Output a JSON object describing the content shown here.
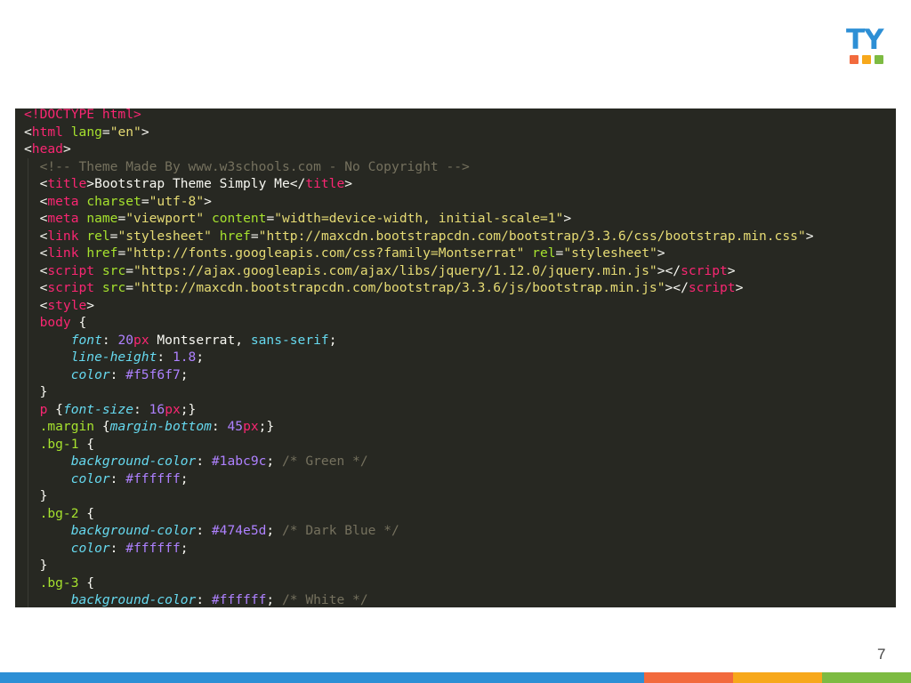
{
  "logo": {
    "text": "TY",
    "icon": "logo-mark",
    "bar_colors": [
      "#f26a3d",
      "#f7a81b",
      "#7dbb42"
    ],
    "text_color": "#2d8fd5"
  },
  "code": {
    "lines": [
      [
        [
          "t",
          "<!DOCTYPE html>"
        ]
      ],
      [
        [
          "pl",
          "<"
        ],
        [
          "t",
          "html"
        ],
        [
          "pl",
          " "
        ],
        [
          "a",
          "lang"
        ],
        [
          "pl",
          "="
        ],
        [
          "s",
          "\"en\""
        ],
        [
          "pl",
          ">"
        ]
      ],
      [
        [
          "pl",
          "<"
        ],
        [
          "t",
          "head"
        ],
        [
          "pl",
          ">"
        ]
      ],
      [
        [
          "pl",
          "  "
        ],
        [
          "c",
          "<!-- Theme Made By www.w3schools.com - No Copyright -->"
        ]
      ],
      [
        [
          "pl",
          "  <"
        ],
        [
          "t",
          "title"
        ],
        [
          "pl",
          ">Bootstrap Theme Simply Me</"
        ],
        [
          "t",
          "title"
        ],
        [
          "pl",
          ">"
        ]
      ],
      [
        [
          "pl",
          "  <"
        ],
        [
          "t",
          "meta"
        ],
        [
          "pl",
          " "
        ],
        [
          "a",
          "charset"
        ],
        [
          "pl",
          "="
        ],
        [
          "s",
          "\"utf-8\""
        ],
        [
          "pl",
          ">"
        ]
      ],
      [
        [
          "pl",
          "  <"
        ],
        [
          "t",
          "meta"
        ],
        [
          "pl",
          " "
        ],
        [
          "a",
          "name"
        ],
        [
          "pl",
          "="
        ],
        [
          "s",
          "\"viewport\""
        ],
        [
          "pl",
          " "
        ],
        [
          "a",
          "content"
        ],
        [
          "pl",
          "="
        ],
        [
          "s",
          "\"width=device-width, initial-scale=1\""
        ],
        [
          "pl",
          ">"
        ]
      ],
      [
        [
          "pl",
          "  <"
        ],
        [
          "t",
          "link"
        ],
        [
          "pl",
          " "
        ],
        [
          "a",
          "rel"
        ],
        [
          "pl",
          "="
        ],
        [
          "s",
          "\"stylesheet\""
        ],
        [
          "pl",
          " "
        ],
        [
          "a",
          "href"
        ],
        [
          "pl",
          "="
        ],
        [
          "s",
          "\"http://maxcdn.bootstrapcdn.com/bootstrap/3.3.6/css/bootstrap.min.css\""
        ],
        [
          "pl",
          ">"
        ]
      ],
      [
        [
          "pl",
          "  <"
        ],
        [
          "t",
          "link"
        ],
        [
          "pl",
          " "
        ],
        [
          "a",
          "href"
        ],
        [
          "pl",
          "="
        ],
        [
          "s",
          "\"http://fonts.googleapis.com/css?family=Montserrat\""
        ],
        [
          "pl",
          " "
        ],
        [
          "a",
          "rel"
        ],
        [
          "pl",
          "="
        ],
        [
          "s",
          "\"stylesheet\""
        ],
        [
          "pl",
          ">"
        ]
      ],
      [
        [
          "pl",
          "  <"
        ],
        [
          "t",
          "script"
        ],
        [
          "pl",
          " "
        ],
        [
          "a",
          "src"
        ],
        [
          "pl",
          "="
        ],
        [
          "s",
          "\"https://ajax.googleapis.com/ajax/libs/jquery/1.12.0/jquery.min.js\""
        ],
        [
          "pl",
          "></"
        ],
        [
          "t",
          "script"
        ],
        [
          "pl",
          ">"
        ]
      ],
      [
        [
          "pl",
          "  <"
        ],
        [
          "t",
          "script"
        ],
        [
          "pl",
          " "
        ],
        [
          "a",
          "src"
        ],
        [
          "pl",
          "="
        ],
        [
          "s",
          "\"http://maxcdn.bootstrapcdn.com/bootstrap/3.3.6/js/bootstrap.min.js\""
        ],
        [
          "pl",
          "></"
        ],
        [
          "t",
          "script"
        ],
        [
          "pl",
          ">"
        ]
      ],
      [
        [
          "pl",
          "  <"
        ],
        [
          "t",
          "style"
        ],
        [
          "pl",
          ">"
        ]
      ],
      [
        [
          "pl",
          "  "
        ],
        [
          "t",
          "body"
        ],
        [
          "pl",
          " {"
        ]
      ],
      [
        [
          "pl",
          "      "
        ],
        [
          "p",
          "font"
        ],
        [
          "pl",
          ": "
        ],
        [
          "n",
          "20"
        ],
        [
          "t",
          "px"
        ],
        [
          "pl",
          " Montserrat, "
        ],
        [
          "k",
          "sans-serif"
        ],
        [
          "pl",
          ";"
        ]
      ],
      [
        [
          "pl",
          "      "
        ],
        [
          "p",
          "line-height"
        ],
        [
          "pl",
          ": "
        ],
        [
          "n",
          "1.8"
        ],
        [
          "pl",
          ";"
        ]
      ],
      [
        [
          "pl",
          "      "
        ],
        [
          "p",
          "color"
        ],
        [
          "pl",
          ": "
        ],
        [
          "n",
          "#f5f6f7"
        ],
        [
          "pl",
          ";"
        ]
      ],
      [
        [
          "pl",
          "  }"
        ]
      ],
      [
        [
          "pl",
          "  "
        ],
        [
          "t",
          "p"
        ],
        [
          "pl",
          " {"
        ],
        [
          "p",
          "font-size"
        ],
        [
          "pl",
          ": "
        ],
        [
          "n",
          "16"
        ],
        [
          "t",
          "px"
        ],
        [
          "pl",
          ";}"
        ]
      ],
      [
        [
          "pl",
          "  "
        ],
        [
          "a",
          ".margin"
        ],
        [
          "pl",
          " {"
        ],
        [
          "p",
          "margin-bottom"
        ],
        [
          "pl",
          ": "
        ],
        [
          "n",
          "45"
        ],
        [
          "t",
          "px"
        ],
        [
          "pl",
          ";}"
        ]
      ],
      [
        [
          "pl",
          "  "
        ],
        [
          "a",
          ".bg-1"
        ],
        [
          "pl",
          " {"
        ]
      ],
      [
        [
          "pl",
          "      "
        ],
        [
          "p",
          "background-color"
        ],
        [
          "pl",
          ": "
        ],
        [
          "n",
          "#1abc9c"
        ],
        [
          "pl",
          "; "
        ],
        [
          "c",
          "/* Green */"
        ]
      ],
      [
        [
          "pl",
          "      "
        ],
        [
          "p",
          "color"
        ],
        [
          "pl",
          ": "
        ],
        [
          "n",
          "#ffffff"
        ],
        [
          "pl",
          ";"
        ]
      ],
      [
        [
          "pl",
          "  }"
        ]
      ],
      [
        [
          "pl",
          "  "
        ],
        [
          "a",
          ".bg-2"
        ],
        [
          "pl",
          " {"
        ]
      ],
      [
        [
          "pl",
          "      "
        ],
        [
          "p",
          "background-color"
        ],
        [
          "pl",
          ": "
        ],
        [
          "n",
          "#474e5d"
        ],
        [
          "pl",
          "; "
        ],
        [
          "c",
          "/* Dark Blue */"
        ]
      ],
      [
        [
          "pl",
          "      "
        ],
        [
          "p",
          "color"
        ],
        [
          "pl",
          ": "
        ],
        [
          "n",
          "#ffffff"
        ],
        [
          "pl",
          ";"
        ]
      ],
      [
        [
          "pl",
          "  }"
        ]
      ],
      [
        [
          "pl",
          "  "
        ],
        [
          "a",
          ".bg-3"
        ],
        [
          "pl",
          " {"
        ]
      ],
      [
        [
          "pl",
          "      "
        ],
        [
          "p",
          "background-color"
        ],
        [
          "pl",
          ": "
        ],
        [
          "n",
          "#ffffff"
        ],
        [
          "pl",
          "; "
        ],
        [
          "c",
          "/* White */"
        ]
      ]
    ]
  },
  "page_number": "7",
  "footer": {
    "colors": [
      "#2d8fd5",
      "#f26a3d",
      "#f7a81b",
      "#7dbb42"
    ]
  }
}
